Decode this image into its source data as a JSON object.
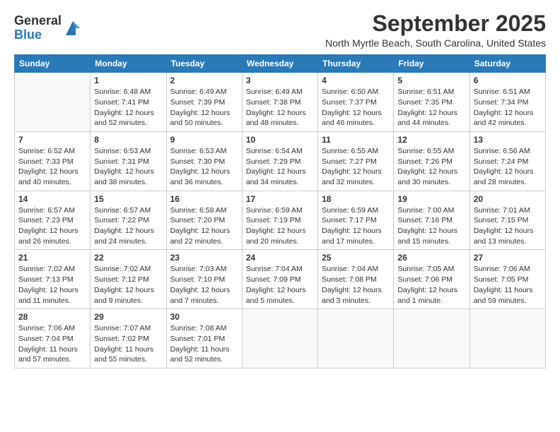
{
  "logo": {
    "general": "General",
    "blue": "Blue"
  },
  "title": "September 2025",
  "location": "North Myrtle Beach, South Carolina, United States",
  "days_of_week": [
    "Sunday",
    "Monday",
    "Tuesday",
    "Wednesday",
    "Thursday",
    "Friday",
    "Saturday"
  ],
  "weeks": [
    [
      {
        "day": "",
        "info": ""
      },
      {
        "day": "1",
        "info": "Sunrise: 6:48 AM\nSunset: 7:41 PM\nDaylight: 12 hours\nand 52 minutes."
      },
      {
        "day": "2",
        "info": "Sunrise: 6:49 AM\nSunset: 7:39 PM\nDaylight: 12 hours\nand 50 minutes."
      },
      {
        "day": "3",
        "info": "Sunrise: 6:49 AM\nSunset: 7:38 PM\nDaylight: 12 hours\nand 48 minutes."
      },
      {
        "day": "4",
        "info": "Sunrise: 6:50 AM\nSunset: 7:37 PM\nDaylight: 12 hours\nand 46 minutes."
      },
      {
        "day": "5",
        "info": "Sunrise: 6:51 AM\nSunset: 7:35 PM\nDaylight: 12 hours\nand 44 minutes."
      },
      {
        "day": "6",
        "info": "Sunrise: 6:51 AM\nSunset: 7:34 PM\nDaylight: 12 hours\nand 42 minutes."
      }
    ],
    [
      {
        "day": "7",
        "info": "Sunrise: 6:52 AM\nSunset: 7:33 PM\nDaylight: 12 hours\nand 40 minutes."
      },
      {
        "day": "8",
        "info": "Sunrise: 6:53 AM\nSunset: 7:31 PM\nDaylight: 12 hours\nand 38 minutes."
      },
      {
        "day": "9",
        "info": "Sunrise: 6:53 AM\nSunset: 7:30 PM\nDaylight: 12 hours\nand 36 minutes."
      },
      {
        "day": "10",
        "info": "Sunrise: 6:54 AM\nSunset: 7:29 PM\nDaylight: 12 hours\nand 34 minutes."
      },
      {
        "day": "11",
        "info": "Sunrise: 6:55 AM\nSunset: 7:27 PM\nDaylight: 12 hours\nand 32 minutes."
      },
      {
        "day": "12",
        "info": "Sunrise: 6:55 AM\nSunset: 7:26 PM\nDaylight: 12 hours\nand 30 minutes."
      },
      {
        "day": "13",
        "info": "Sunrise: 6:56 AM\nSunset: 7:24 PM\nDaylight: 12 hours\nand 28 minutes."
      }
    ],
    [
      {
        "day": "14",
        "info": "Sunrise: 6:57 AM\nSunset: 7:23 PM\nDaylight: 12 hours\nand 26 minutes."
      },
      {
        "day": "15",
        "info": "Sunrise: 6:57 AM\nSunset: 7:22 PM\nDaylight: 12 hours\nand 24 minutes."
      },
      {
        "day": "16",
        "info": "Sunrise: 6:58 AM\nSunset: 7:20 PM\nDaylight: 12 hours\nand 22 minutes."
      },
      {
        "day": "17",
        "info": "Sunrise: 6:59 AM\nSunset: 7:19 PM\nDaylight: 12 hours\nand 20 minutes."
      },
      {
        "day": "18",
        "info": "Sunrise: 6:59 AM\nSunset: 7:17 PM\nDaylight: 12 hours\nand 17 minutes."
      },
      {
        "day": "19",
        "info": "Sunrise: 7:00 AM\nSunset: 7:16 PM\nDaylight: 12 hours\nand 15 minutes."
      },
      {
        "day": "20",
        "info": "Sunrise: 7:01 AM\nSunset: 7:15 PM\nDaylight: 12 hours\nand 13 minutes."
      }
    ],
    [
      {
        "day": "21",
        "info": "Sunrise: 7:02 AM\nSunset: 7:13 PM\nDaylight: 12 hours\nand 11 minutes."
      },
      {
        "day": "22",
        "info": "Sunrise: 7:02 AM\nSunset: 7:12 PM\nDaylight: 12 hours\nand 9 minutes."
      },
      {
        "day": "23",
        "info": "Sunrise: 7:03 AM\nSunset: 7:10 PM\nDaylight: 12 hours\nand 7 minutes."
      },
      {
        "day": "24",
        "info": "Sunrise: 7:04 AM\nSunset: 7:09 PM\nDaylight: 12 hours\nand 5 minutes."
      },
      {
        "day": "25",
        "info": "Sunrise: 7:04 AM\nSunset: 7:08 PM\nDaylight: 12 hours\nand 3 minutes."
      },
      {
        "day": "26",
        "info": "Sunrise: 7:05 AM\nSunset: 7:06 PM\nDaylight: 12 hours\nand 1 minute."
      },
      {
        "day": "27",
        "info": "Sunrise: 7:06 AM\nSunset: 7:05 PM\nDaylight: 11 hours\nand 59 minutes."
      }
    ],
    [
      {
        "day": "28",
        "info": "Sunrise: 7:06 AM\nSunset: 7:04 PM\nDaylight: 11 hours\nand 57 minutes."
      },
      {
        "day": "29",
        "info": "Sunrise: 7:07 AM\nSunset: 7:02 PM\nDaylight: 11 hours\nand 55 minutes."
      },
      {
        "day": "30",
        "info": "Sunrise: 7:08 AM\nSunset: 7:01 PM\nDaylight: 11 hours\nand 52 minutes."
      },
      {
        "day": "",
        "info": ""
      },
      {
        "day": "",
        "info": ""
      },
      {
        "day": "",
        "info": ""
      },
      {
        "day": "",
        "info": ""
      }
    ]
  ]
}
